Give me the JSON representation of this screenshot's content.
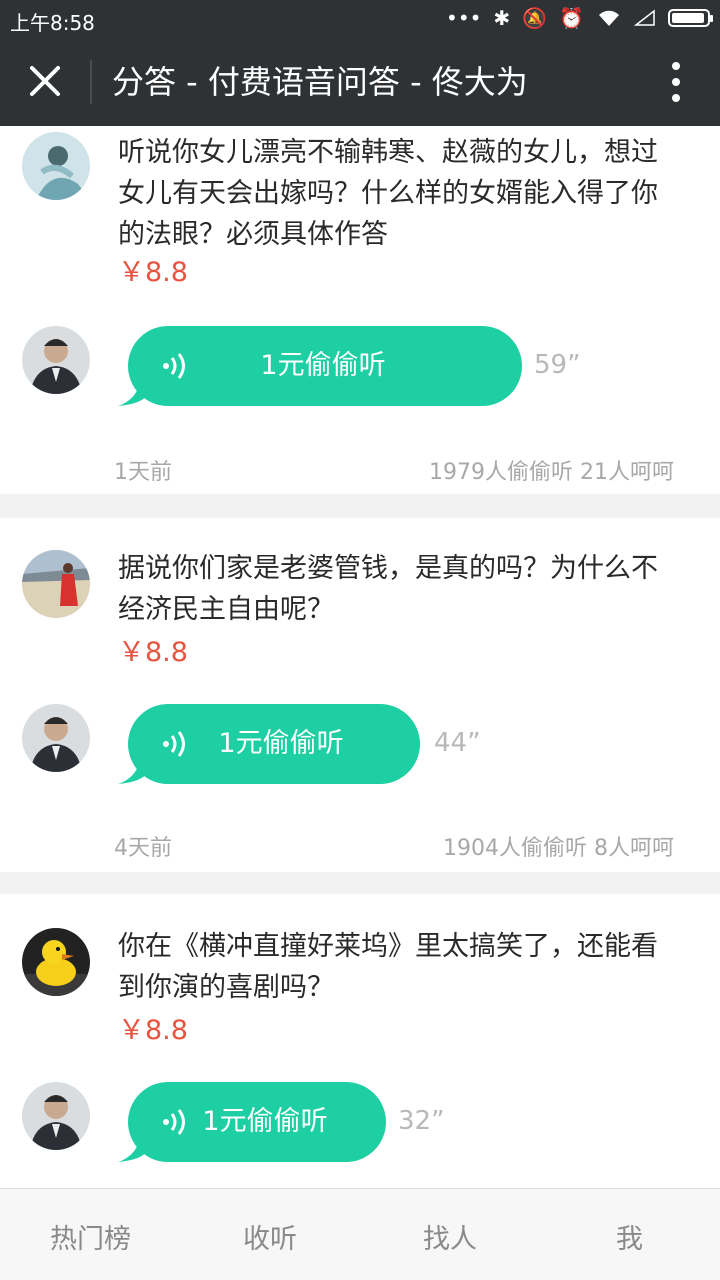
{
  "status": {
    "time": "上午8:58"
  },
  "header": {
    "title": "分答 - 付费语音问答 - 佟大为"
  },
  "questions": [
    {
      "text": "听说你女儿漂亮不输韩寒、赵薇的女儿，想过女儿有天会出嫁吗？什么样的女婿能入得了你的法眼？必须具体作答",
      "price": "￥8.8",
      "listen_label": "1元偷偷听",
      "duration": "59”",
      "time_ago": "1天前",
      "stats": "1979人偷偷听  21人呵呵"
    },
    {
      "text": "据说你们家是老婆管钱，是真的吗？为什么不经济民主自由呢？",
      "price": "￥8.8",
      "listen_label": "1元偷偷听",
      "duration": "44”",
      "time_ago": "4天前",
      "stats": "1904人偷偷听  8人呵呵"
    },
    {
      "text": "你在《横冲直撞好莱坞》里太搞笑了，还能看到你演的喜剧吗？",
      "price": "￥8.8",
      "listen_label": "1元偷偷听",
      "duration": "32”"
    }
  ],
  "tabs": [
    "热门榜",
    "收听",
    "找人",
    "我"
  ],
  "colors": {
    "accent": "#1ecfa4",
    "price": "#e8543f",
    "bar": "#2f3234"
  }
}
